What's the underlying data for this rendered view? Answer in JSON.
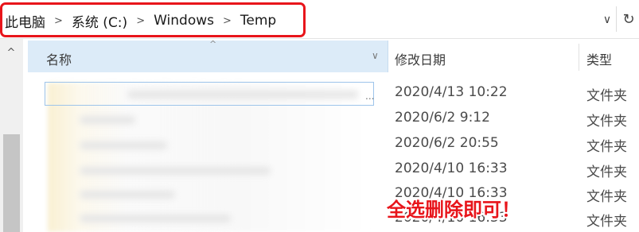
{
  "breadcrumb": {
    "items": [
      "此电脑",
      "系统 (C:)",
      "Windows",
      "Temp"
    ],
    "separator": "›"
  },
  "address_bar": {
    "dropdown_icon": "chevron-down-icon",
    "refresh_icon": "refresh-icon"
  },
  "scrollbar": {
    "up_icon": "chevron-up-icon"
  },
  "columns": {
    "name": "名称",
    "date_modified": "修改日期",
    "type": "类型"
  },
  "rows": [
    {
      "date": "2020/4/13 10:22",
      "type": "文件夹"
    },
    {
      "date": "2020/6/2 9:12",
      "type": "文件夹"
    },
    {
      "date": "2020/6/2 20:55",
      "type": "文件夹"
    },
    {
      "date": "2020/4/10 16:33",
      "type": "文件夹"
    },
    {
      "date": "2020/4/10 16:33",
      "type": "文件夹"
    },
    {
      "date": "2020/4/10 16:33",
      "type": "文件夹"
    }
  ],
  "annotation": {
    "text": "全选删除即可！",
    "color": "#e8151b"
  }
}
